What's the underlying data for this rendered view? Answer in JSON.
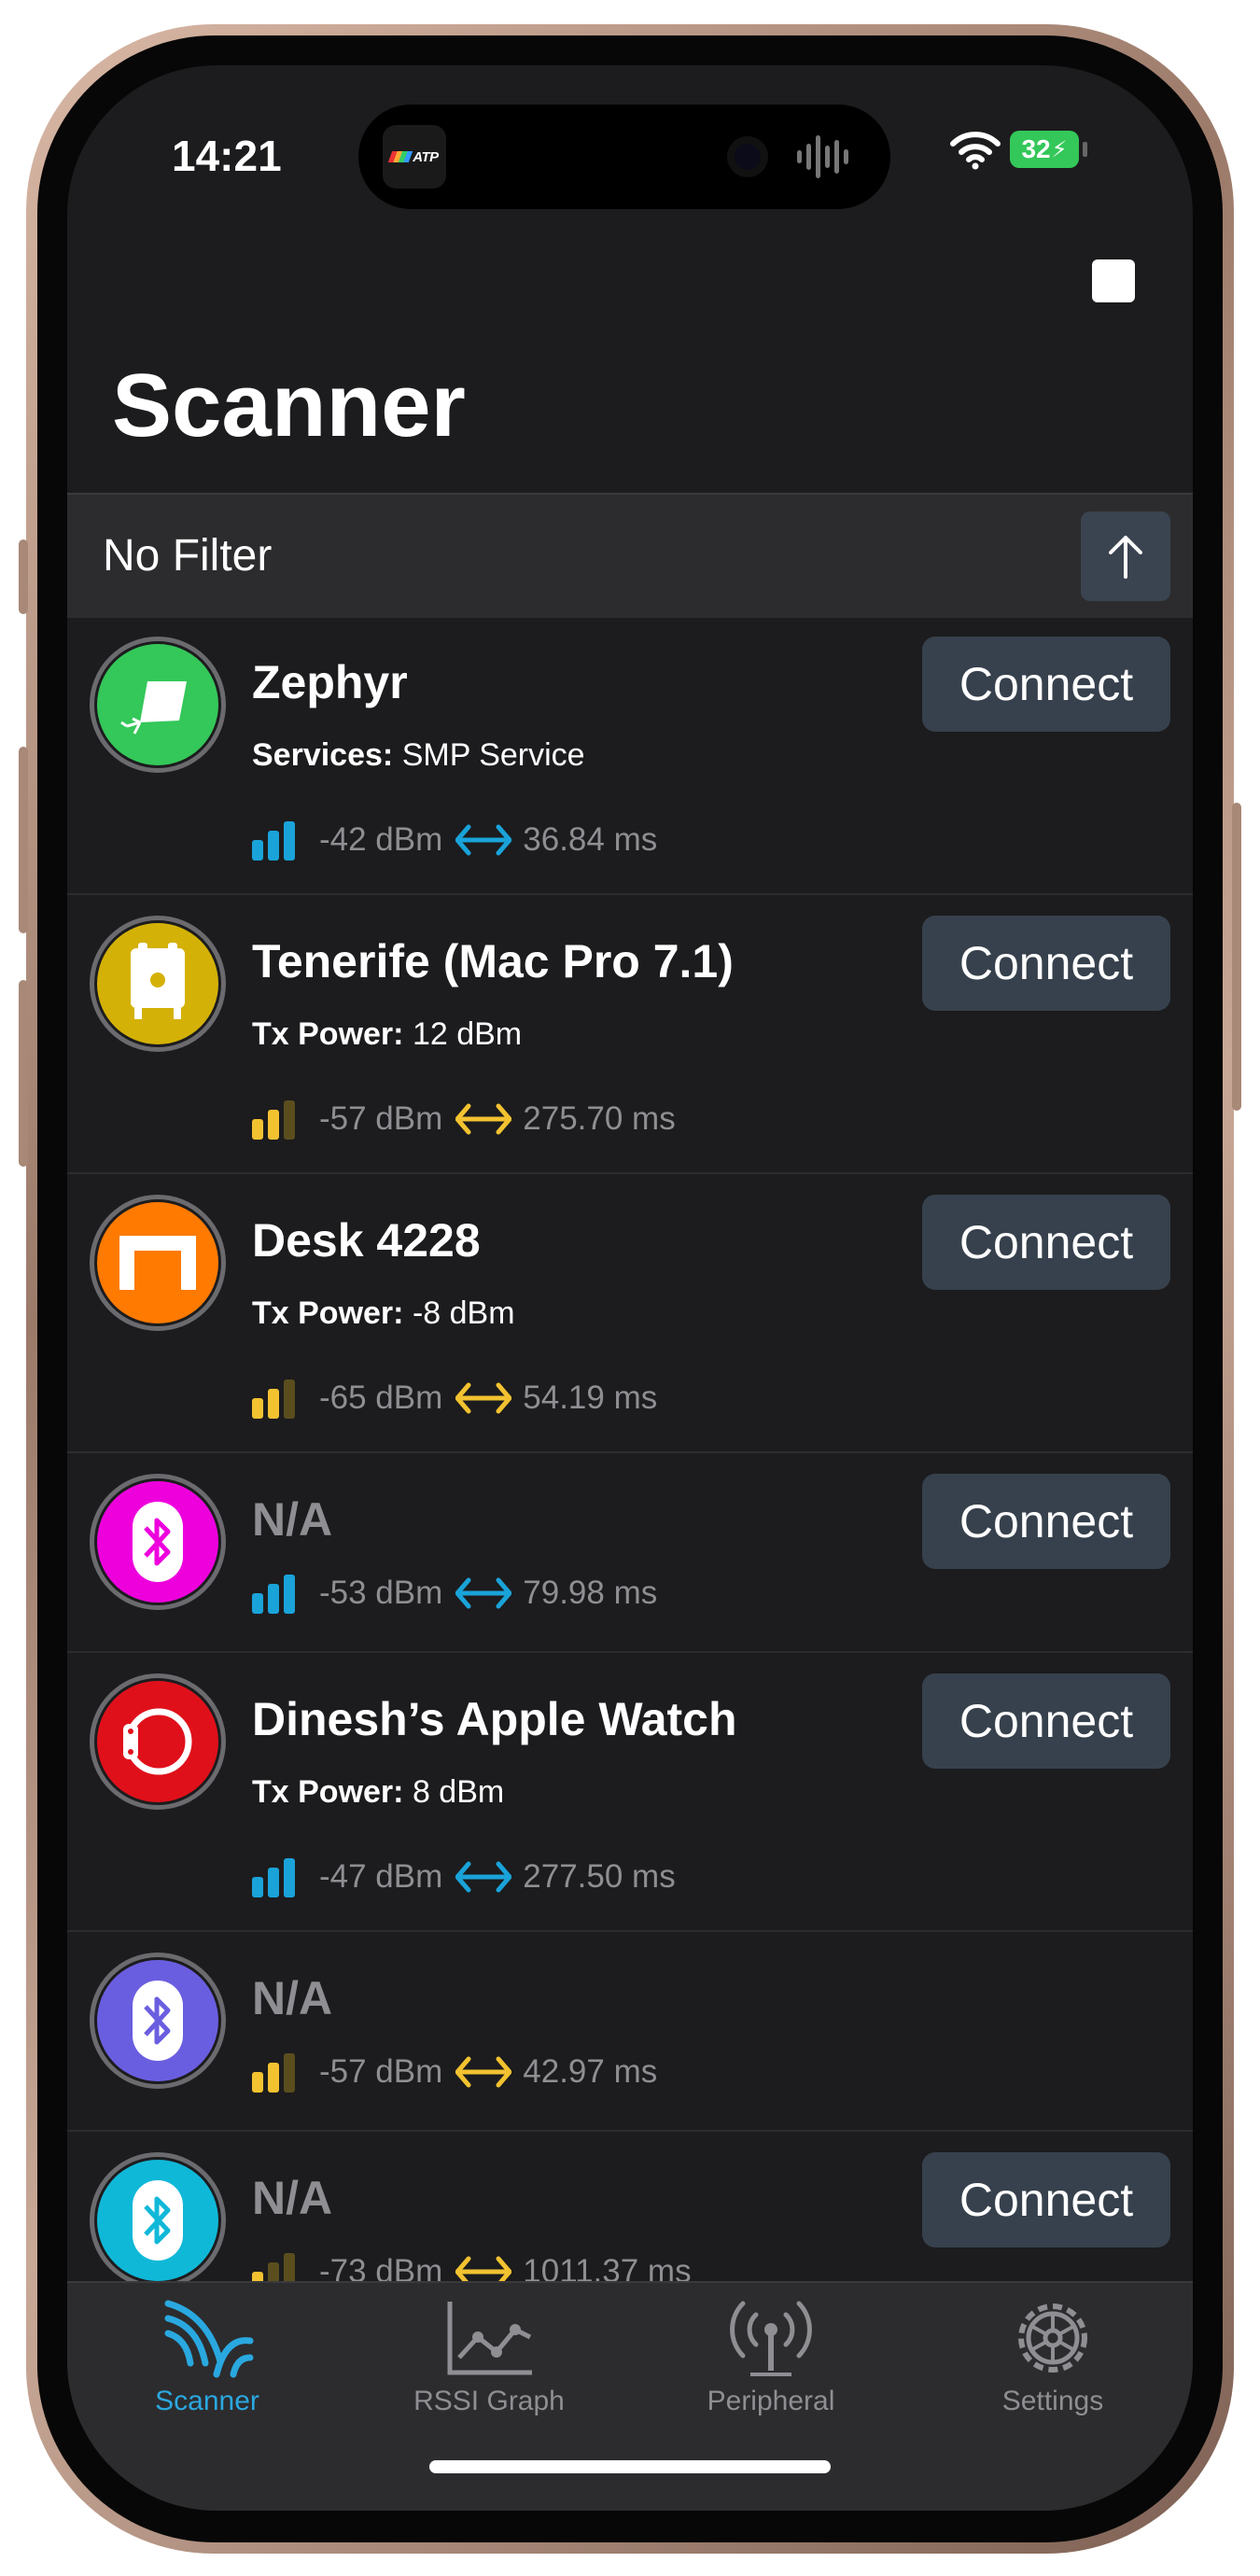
{
  "status_bar": {
    "time": "14:21",
    "battery": "32"
  },
  "island": {
    "app_badge": "ATP"
  },
  "header": {
    "title": "Scanner"
  },
  "filter": {
    "label": "No Filter"
  },
  "devices": [
    {
      "name": "Zephyr",
      "detail_label": "Services:",
      "detail_value": "SMP Service",
      "rssi": "-42 dBm",
      "interval": "36.84 ms",
      "signal_color": "#1aa3d9",
      "signal_level": 3,
      "avatar_color": "#34c759",
      "icon": "kite-icon",
      "connect_label": "Connect"
    },
    {
      "name": "Tenerife (Mac Pro 7.1)",
      "detail_label": "Tx Power:",
      "detail_value": "12 dBm",
      "rssi": "-57 dBm",
      "interval": "275.70 ms",
      "signal_color": "#f2c230",
      "signal_level": 2,
      "avatar_color": "#d4b106",
      "icon": "mac-pro-icon",
      "connect_label": "Connect"
    },
    {
      "name": "Desk 4228",
      "detail_label": "Tx Power:",
      "detail_value": "-8 dBm",
      "rssi": "-65 dBm",
      "interval": "54.19 ms",
      "signal_color": "#f2c230",
      "signal_level": 2,
      "avatar_color": "#ff7a00",
      "icon": "desk-icon",
      "connect_label": "Connect"
    },
    {
      "name": "N/A",
      "rssi": "-53 dBm",
      "interval": "79.98 ms",
      "signal_color": "#1aa3d9",
      "signal_level": 3,
      "avatar_color": "#ee00dd",
      "icon": "bluetooth-icon",
      "connect_label": "Connect"
    },
    {
      "name": "Dinesh’s Apple Watch",
      "detail_label": "Tx Power:",
      "detail_value": "8 dBm",
      "rssi": "-47 dBm",
      "interval": "277.50 ms",
      "signal_color": "#1aa3d9",
      "signal_level": 3,
      "avatar_color": "#e0101a",
      "icon": "watch-icon",
      "connect_label": "Connect"
    },
    {
      "name": "N/A",
      "rssi": "-57 dBm",
      "interval": "42.97 ms",
      "signal_color": "#f2c230",
      "signal_level": 2,
      "avatar_color": "#6a5ee0",
      "icon": "bluetooth-icon"
    },
    {
      "name": "N/A",
      "rssi": "-73 dBm",
      "interval": "1011.37 ms",
      "signal_color": "#f2c230",
      "signal_level": 1,
      "avatar_color": "#10b8d8",
      "icon": "bluetooth-icon",
      "connect_label": "Connect"
    }
  ],
  "tabs": [
    {
      "label": "Scanner",
      "icon": "scanner-icon",
      "active": true
    },
    {
      "label": "RSSI Graph",
      "icon": "graph-icon",
      "active": false
    },
    {
      "label": "Peripheral",
      "icon": "antenna-icon",
      "active": false
    },
    {
      "label": "Settings",
      "icon": "gear-icon",
      "active": false
    }
  ],
  "colors": {
    "accent": "#2aa8e0",
    "background": "#1c1c1e",
    "button": "#37414d"
  }
}
